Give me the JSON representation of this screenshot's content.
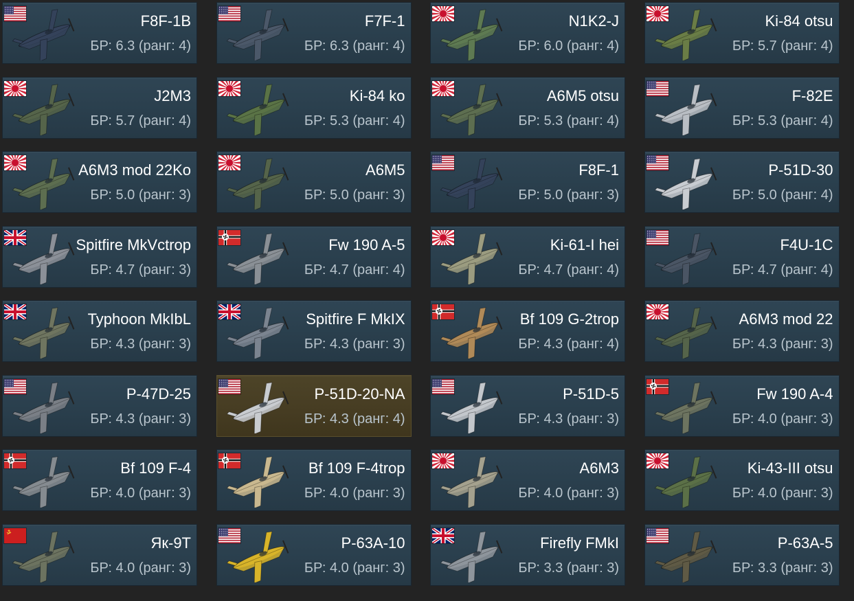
{
  "colors": {
    "card_bg": "#2c414f",
    "card_selected_bg": "#4a4026",
    "page_bg": "#232323",
    "name_text": "#ffffff",
    "br_text": "#b9c5cd"
  },
  "vehicles": [
    {
      "name": "F8F-1B",
      "br": "БР: 6.3 (ранг: 4)",
      "flag": "usa",
      "plane_color": "#34425a"
    },
    {
      "name": "F7F-1",
      "br": "БР: 6.3 (ранг: 4)",
      "flag": "usa",
      "plane_color": "#4b5869"
    },
    {
      "name": "N1K2-J",
      "br": "БР: 6.0 (ранг: 4)",
      "flag": "japan",
      "plane_color": "#5e7a52"
    },
    {
      "name": "Ki-84 otsu",
      "br": "БР: 5.7 (ранг: 4)",
      "flag": "japan",
      "plane_color": "#6a7d46"
    },
    {
      "name": "J2M3",
      "br": "БР: 5.7 (ранг: 4)",
      "flag": "japan",
      "plane_color": "#55644a"
    },
    {
      "name": "Ki-84 ko",
      "br": "БР: 5.3 (ранг: 4)",
      "flag": "japan",
      "plane_color": "#5a7346"
    },
    {
      "name": "A6M5 otsu",
      "br": "БР: 5.3 (ранг: 4)",
      "flag": "japan",
      "plane_color": "#5d6e50"
    },
    {
      "name": "F-82E",
      "br": "БР: 5.3 (ранг: 4)",
      "flag": "usa",
      "plane_color": "#b9bec4"
    },
    {
      "name": "A6M3 mod 22Ko",
      "br": "БР: 5.0 (ранг: 3)",
      "flag": "japan",
      "plane_color": "#5d6e50"
    },
    {
      "name": "A6M5",
      "br": "БР: 5.0 (ранг: 3)",
      "flag": "japan",
      "plane_color": "#55644a"
    },
    {
      "name": "F8F-1",
      "br": "БР: 5.0 (ранг: 3)",
      "flag": "usa",
      "plane_color": "#34425a"
    },
    {
      "name": "P-51D-30",
      "br": "БР: 5.0 (ранг: 4)",
      "flag": "usa",
      "plane_color": "#c8ccd1"
    },
    {
      "name": "Spitfire MkVctrop",
      "br": "БР: 4.7 (ранг: 3)",
      "flag": "uk",
      "plane_color": "#8b9098"
    },
    {
      "name": "Fw 190 A-5",
      "br": "БР: 4.7 (ранг: 4)",
      "flag": "germany",
      "plane_color": "#8a9096"
    },
    {
      "name": "Ki-61-I hei",
      "br": "БР: 4.7 (ранг: 4)",
      "flag": "japan",
      "plane_color": "#9b9c80"
    },
    {
      "name": "F4U-1C",
      "br": "БР: 4.7 (ранг: 4)",
      "flag": "usa",
      "plane_color": "#4a5564"
    },
    {
      "name": "Typhoon MkIbL",
      "br": "БР: 4.3 (ранг: 3)",
      "flag": "uk",
      "plane_color": "#6f7560"
    },
    {
      "name": "Spitfire F MkIX",
      "br": "БР: 4.3 (ранг: 3)",
      "flag": "uk",
      "plane_color": "#7b8490"
    },
    {
      "name": "Bf 109 G-2trop",
      "br": "БР: 4.3 (ранг: 4)",
      "flag": "germany",
      "plane_color": "#b08a58"
    },
    {
      "name": "A6M3 mod 22",
      "br": "БР: 4.3 (ранг: 3)",
      "flag": "japan",
      "plane_color": "#55644a"
    },
    {
      "name": "P-47D-25",
      "br": "БР: 4.3 (ранг: 3)",
      "flag": "usa",
      "plane_color": "#7a7f86"
    },
    {
      "name": "P-51D-20-NA",
      "br": "БР: 4.3 (ранг: 4)",
      "flag": "usa",
      "plane_color": "#c9ccd0",
      "selected": true
    },
    {
      "name": "P-51D-5",
      "br": "БР: 4.3 (ранг: 3)",
      "flag": "usa",
      "plane_color": "#c3c7cc"
    },
    {
      "name": "Fw 190 A-4",
      "br": "БР: 4.0 (ранг: 3)",
      "flag": "germany",
      "plane_color": "#6d7460"
    },
    {
      "name": "Bf 109 F-4",
      "br": "БР: 4.0 (ранг: 3)",
      "flag": "germany",
      "plane_color": "#858b90"
    },
    {
      "name": "Bf 109 F-4trop",
      "br": "БР: 4.0 (ранг: 3)",
      "flag": "germany",
      "plane_color": "#c9b88f"
    },
    {
      "name": "A6M3",
      "br": "БР: 4.0 (ранг: 3)",
      "flag": "japan",
      "plane_color": "#a4a18e"
    },
    {
      "name": "Ki-43-III otsu",
      "br": "БР: 4.0 (ранг: 3)",
      "flag": "japan",
      "plane_color": "#5b7047"
    },
    {
      "name": "Як-9Т",
      "br": "БР: 4.0 (ранг: 3)",
      "flag": "ussr",
      "plane_color": "#6c7360"
    },
    {
      "name": "P-63A-10",
      "br": "БР: 4.0 (ранг: 3)",
      "flag": "usa",
      "plane_color": "#d8b42a"
    },
    {
      "name": "Firefly FMkI",
      "br": "БР: 3.3 (ранг: 3)",
      "flag": "uk",
      "plane_color": "#8e959c"
    },
    {
      "name": "P-63A-5",
      "br": "БР: 3.3 (ранг: 3)",
      "flag": "usa",
      "plane_color": "#5f5a45"
    }
  ]
}
